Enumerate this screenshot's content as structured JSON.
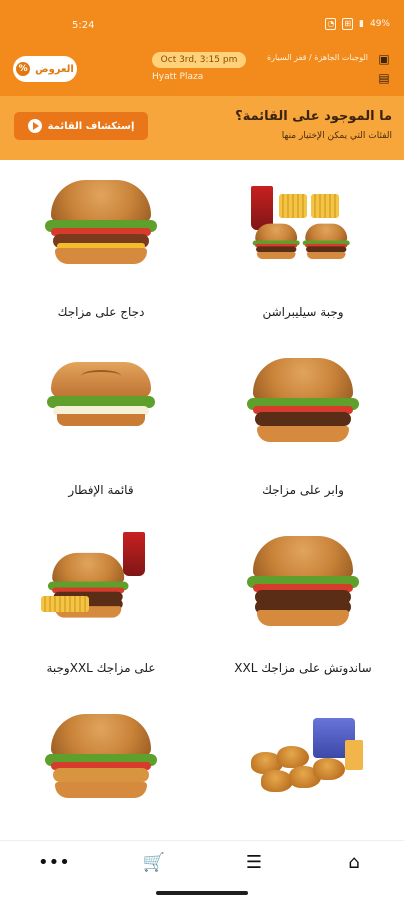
{
  "status": {
    "time": "5:24",
    "icons": [
      "headset-icon",
      "data-icon",
      "battery-icon"
    ],
    "battery": "49%"
  },
  "header": {
    "offers_label": "العروض",
    "offers_icon": "percent-icon",
    "date": "Oct 3rd, 3:15 pm",
    "order_type": "الوجبات الجاهزة / قفز السيارة",
    "store": "Hyatt Plaza",
    "basket_icon": "basket-icon",
    "store_icon": "store-icon",
    "accent_color": "#f28a1c"
  },
  "banner": {
    "title": "ما الموجود على القائمة؟",
    "subtitle": "الفئات التي يمكن الإختيار منها",
    "button_label": "إستكشاف القائمة",
    "button_color": "#e9771a",
    "background": "#f6a63a"
  },
  "categories": [
    {
      "label": "وجبة سيليبراشن",
      "image": "celebration-meal-image"
    },
    {
      "label": "دجاج على مزاجك",
      "image": "chicken-burger-image"
    },
    {
      "label": "وابر على مزاجك",
      "image": "whopper-image"
    },
    {
      "label": "قائمة الإفطار",
      "image": "croissant-breakfast-image"
    },
    {
      "label": "ساندوتش على مزاجك XXL",
      "image": "xxl-burger-image"
    },
    {
      "label": "على مزاجك XXLوجبة",
      "image": "xxl-meal-image"
    },
    {
      "label": "",
      "image": "nuggets-kids-meal-image"
    },
    {
      "label": "",
      "image": "crispy-chicken-burger-image"
    }
  ],
  "bottom_nav": [
    {
      "name": "home",
      "icon": "home-icon"
    },
    {
      "name": "menu",
      "icon": "menu-list-icon"
    },
    {
      "name": "cart",
      "icon": "cart-icon"
    },
    {
      "name": "more",
      "icon": "more-icon"
    }
  ]
}
